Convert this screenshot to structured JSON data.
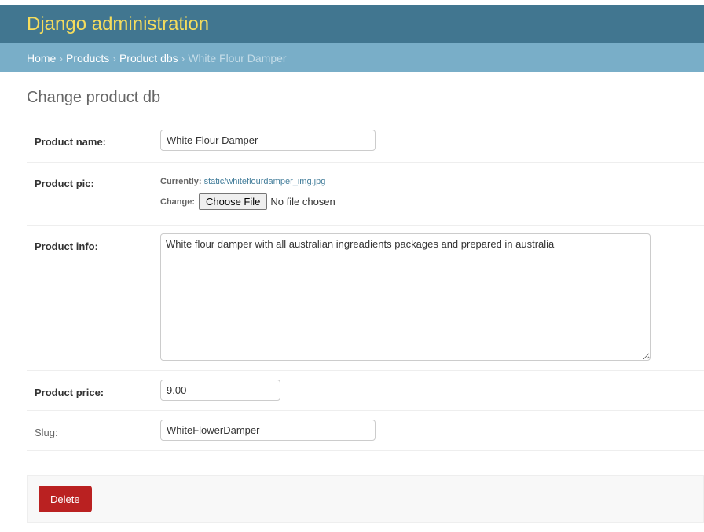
{
  "header": {
    "title": "Django administration"
  },
  "breadcrumbs": {
    "items": [
      "Home",
      "Products",
      "Product dbs"
    ],
    "current": "White Flour Damper",
    "separator": "›"
  },
  "page": {
    "title": "Change product db"
  },
  "form": {
    "product_name": {
      "label": "Product name:",
      "value": "White Flour Damper"
    },
    "product_pic": {
      "label": "Product pic:",
      "currently_label": "Currently:",
      "currently_value": "static/whiteflourdamper_img.jpg",
      "change_label": "Change:",
      "choose_button": "Choose File",
      "no_file": "No file chosen"
    },
    "product_info": {
      "label": "Product info:",
      "value": "White flour damper with all australian ingreadients packages and prepared in australia"
    },
    "product_price": {
      "label": "Product price:",
      "value": "9.00"
    },
    "slug": {
      "label": "Slug:",
      "value": "WhiteFlowerDamper"
    }
  },
  "actions": {
    "delete_label": "Delete"
  },
  "colors": {
    "header_bg": "#417690",
    "header_text": "#f5dd5d",
    "breadcrumbs_bg": "#79aec8",
    "delete_bg": "#ba2121",
    "link": "#447e9b"
  }
}
